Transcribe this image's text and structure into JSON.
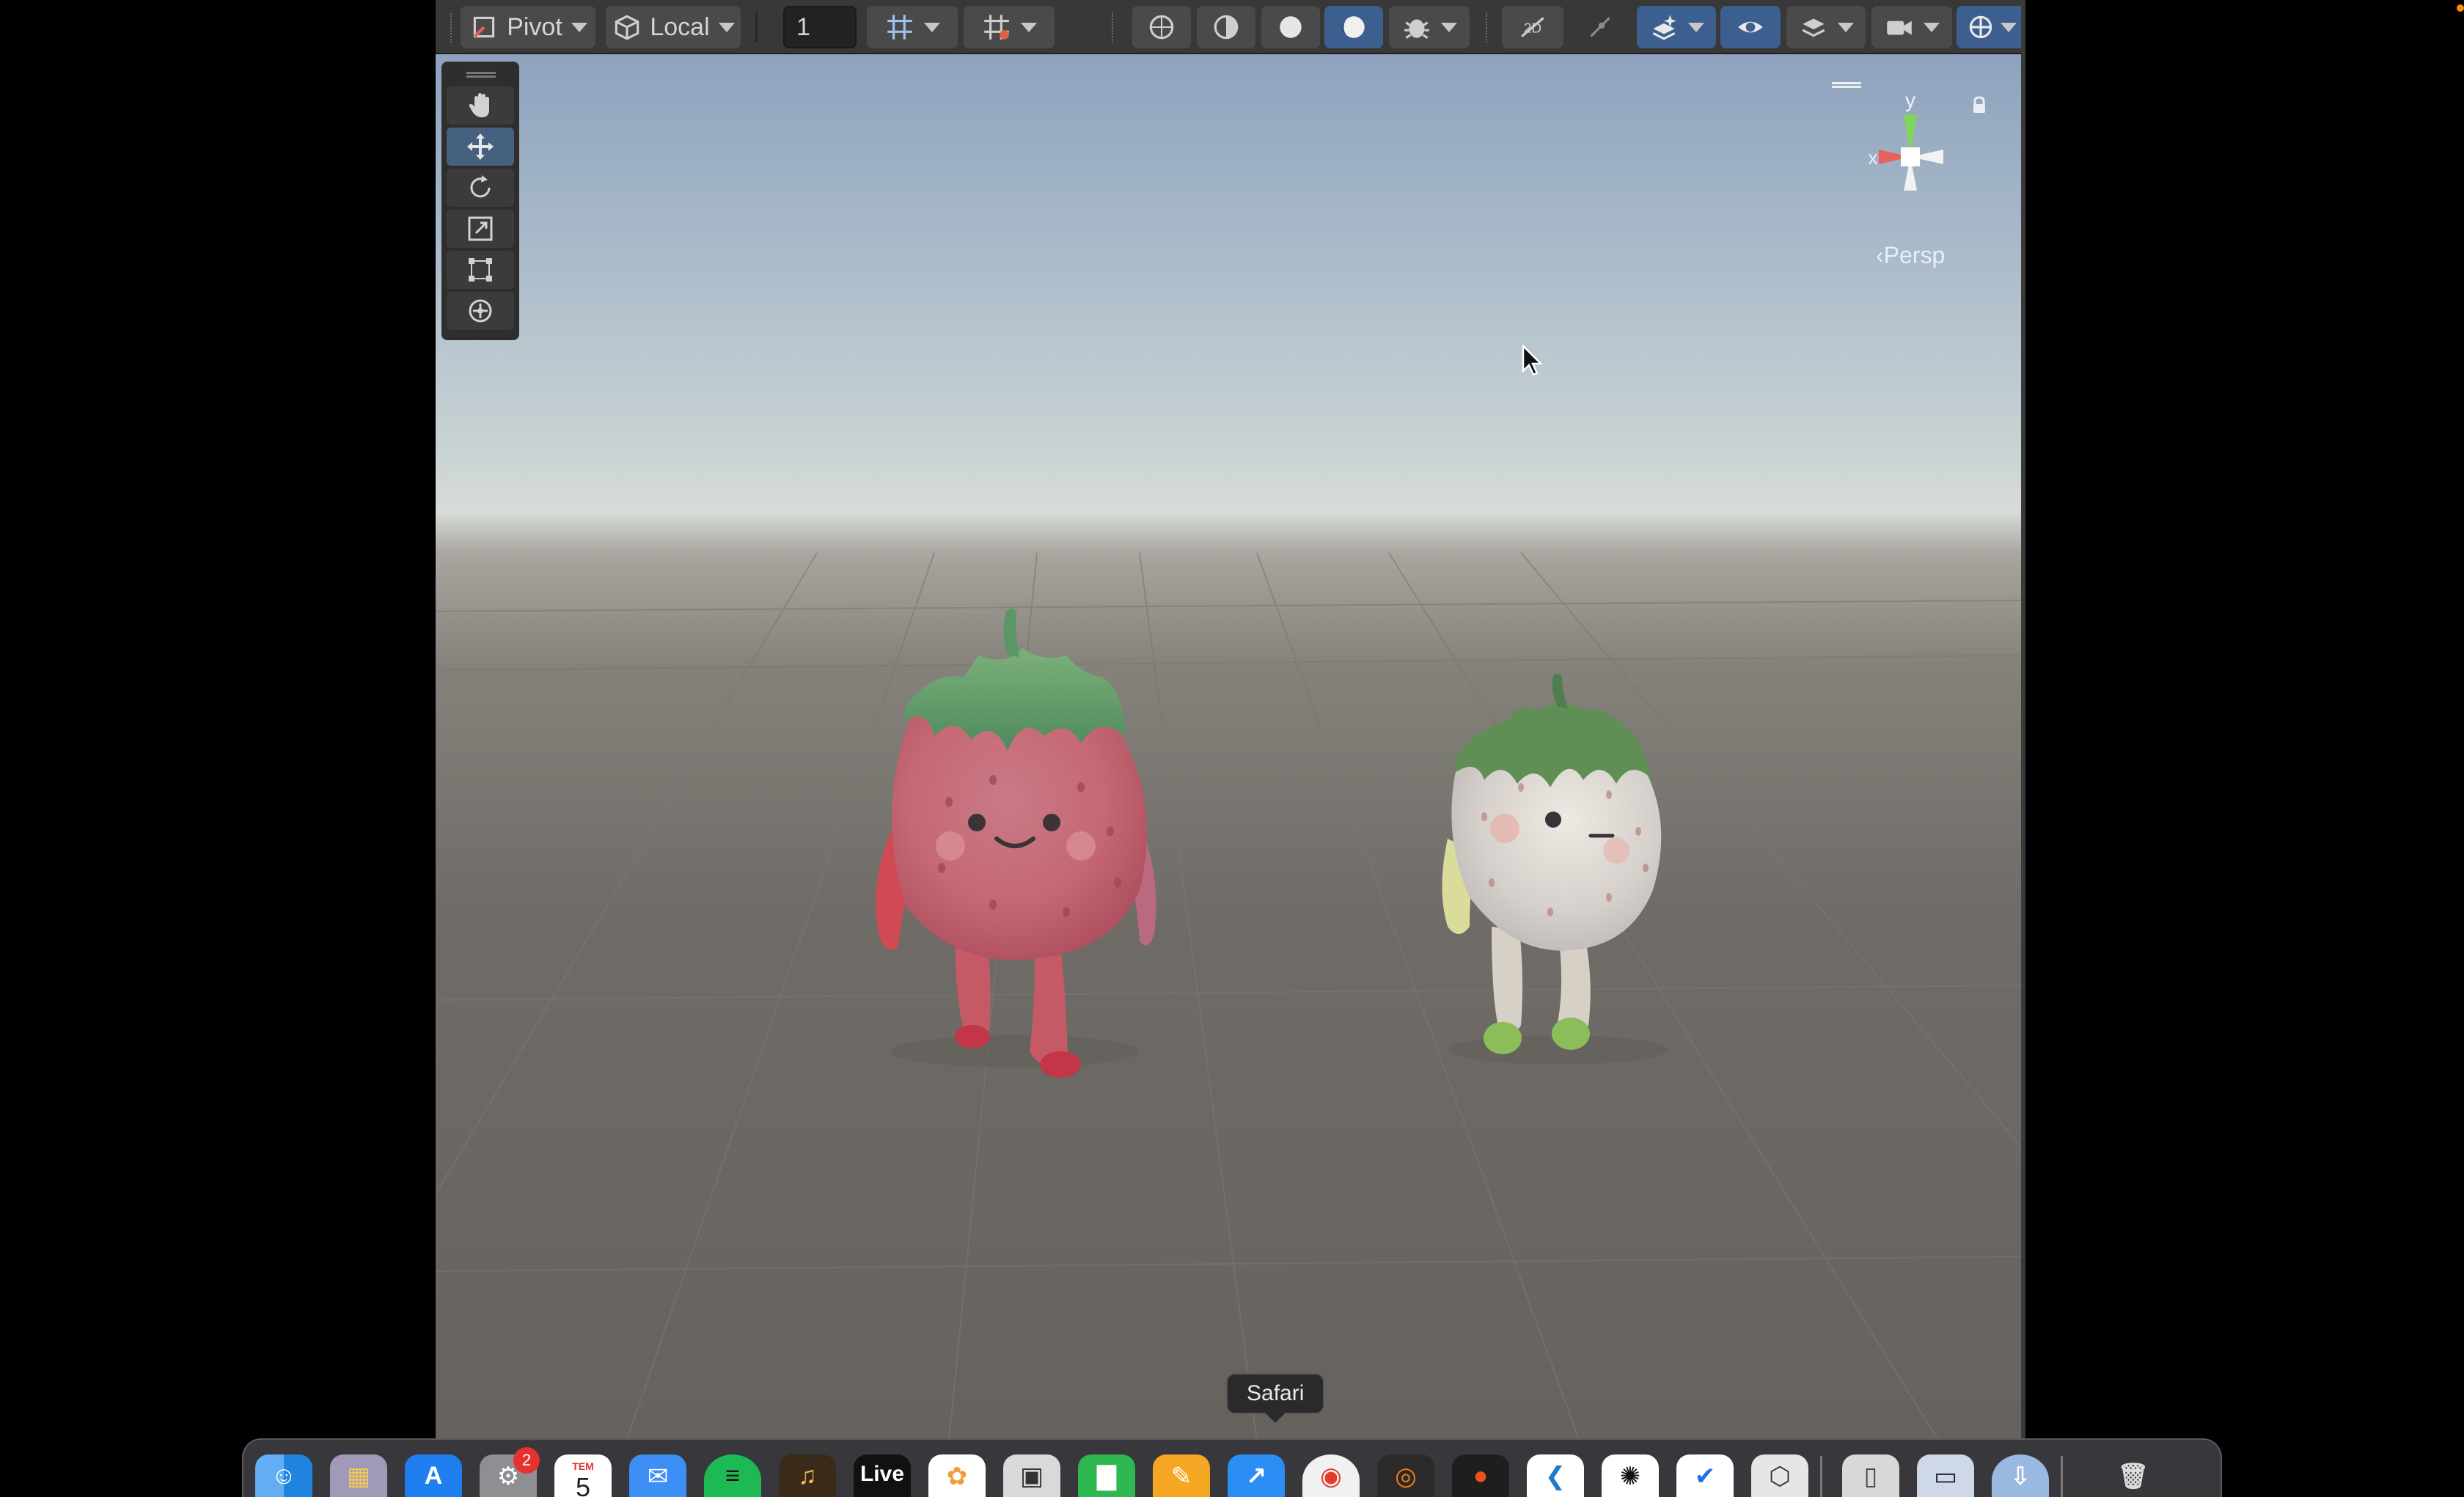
{
  "toolbar": {
    "pivot_label": "Pivot",
    "space_label": "Local",
    "snap_increment_value": "1"
  },
  "tools": [
    "hand-tool",
    "move-tool",
    "rotate-tool",
    "scale-tool",
    "rect-tool",
    "transform-tool"
  ],
  "active_tool": "move-tool",
  "gizmo": {
    "y_axis_label": "y",
    "x_axis_label": "x",
    "projection_label": "Persp"
  },
  "scene": {
    "objects": [
      "red-strawberry-character",
      "white-strawberry-character"
    ]
  },
  "dock": {
    "tooltip": "Safari",
    "calendar_month": "TEM",
    "calendar_day": "5",
    "live_label": "Live",
    "settings_badge_count": "2"
  },
  "colors": {
    "toolbar_bg": "#383838",
    "active_button": "#3d5f8f",
    "x_axis": "#e8615a",
    "y_axis": "#7fd65a",
    "strawberry_red": "#d95a5e",
    "leaf_green": "#5f9a64"
  }
}
